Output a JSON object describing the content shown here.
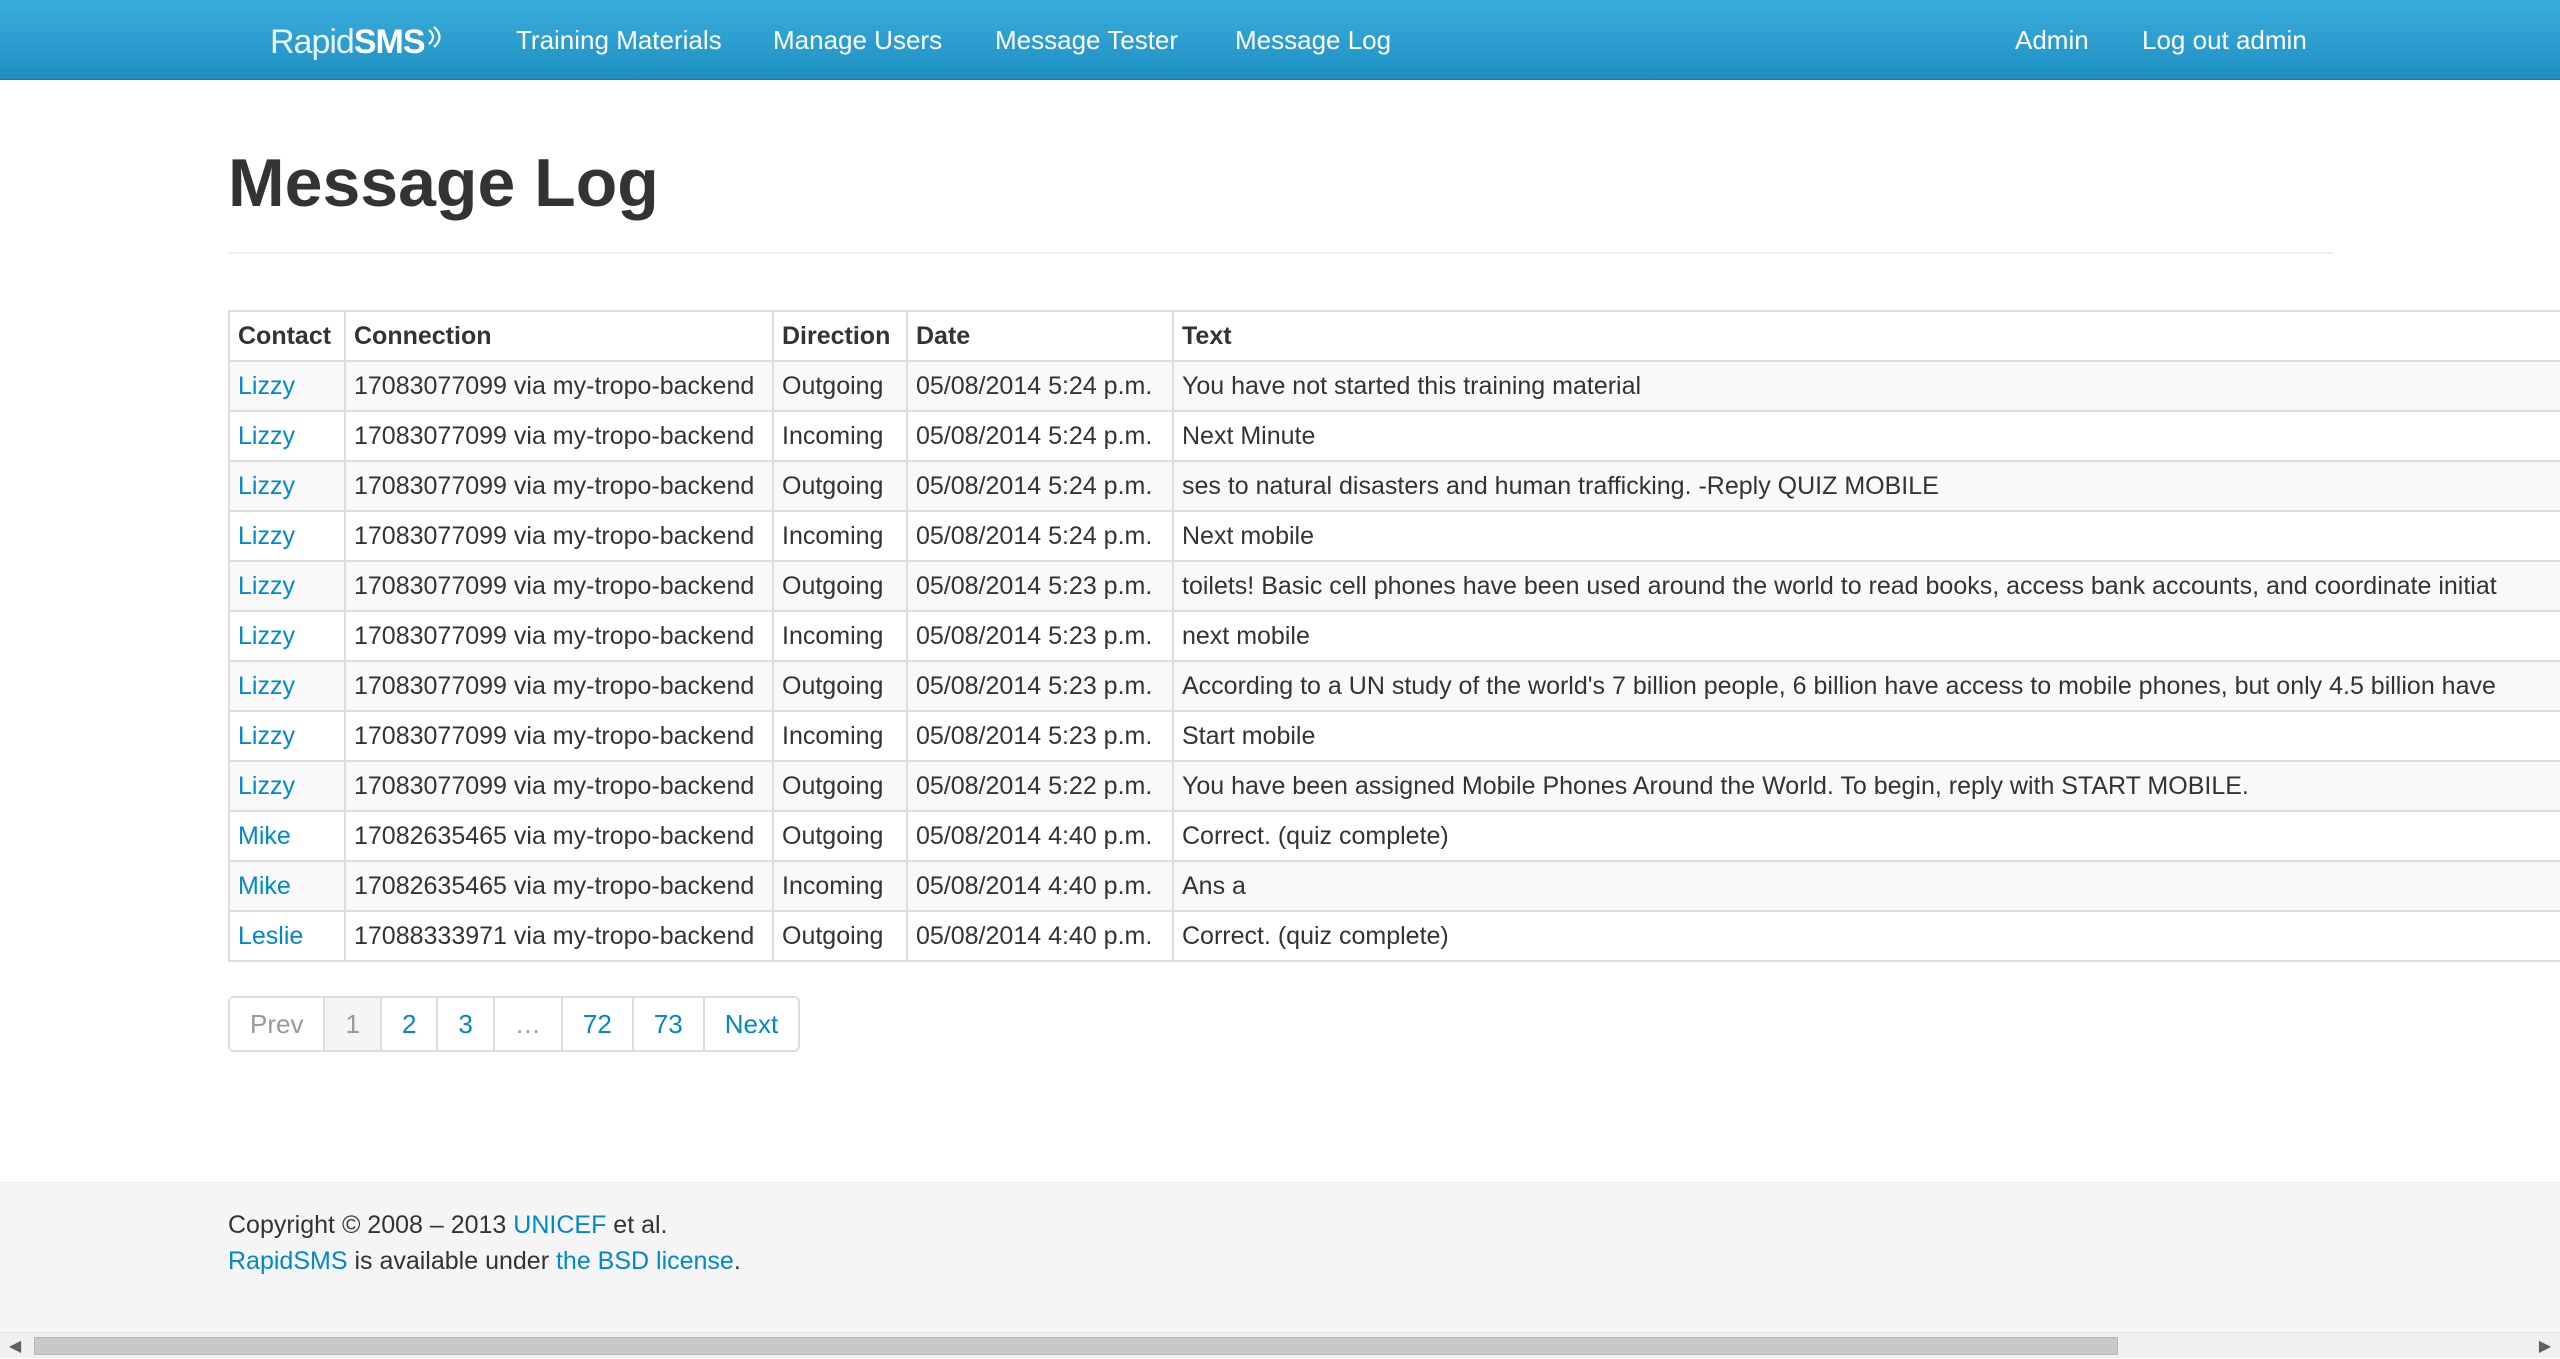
{
  "navbar": {
    "brand_light": "Rapid",
    "brand_bold": "SMS",
    "links": [
      "Training Materials",
      "Manage Users",
      "Message Tester",
      "Message Log"
    ],
    "admin": "Admin",
    "logout": "Log out admin",
    "colors": {
      "bar": "#1f8fc2",
      "text": "#ffffff"
    }
  },
  "page": {
    "title": "Message Log"
  },
  "table": {
    "headers": [
      "Contact",
      "Connection",
      "Direction",
      "Date",
      "Text"
    ],
    "rows": [
      [
        "Lizzy",
        "17083077099 via my-tropo-backend",
        "Outgoing",
        "05/08/2014 5:24 p.m.",
        "You have not started this training material"
      ],
      [
        "Lizzy",
        "17083077099 via my-tropo-backend",
        "Incoming",
        "05/08/2014 5:24 p.m.",
        "Next Minute"
      ],
      [
        "Lizzy",
        "17083077099 via my-tropo-backend",
        "Outgoing",
        "05/08/2014 5:24 p.m.",
        "ses to natural disasters and human trafficking. -Reply QUIZ MOBILE"
      ],
      [
        "Lizzy",
        "17083077099 via my-tropo-backend",
        "Incoming",
        "05/08/2014 5:24 p.m.",
        "Next mobile"
      ],
      [
        "Lizzy",
        "17083077099 via my-tropo-backend",
        "Outgoing",
        "05/08/2014 5:23 p.m.",
        "toilets! Basic cell phones have been used around the world to read books, access bank accounts, and coordinate initiat"
      ],
      [
        "Lizzy",
        "17083077099 via my-tropo-backend",
        "Incoming",
        "05/08/2014 5:23 p.m.",
        "next mobile"
      ],
      [
        "Lizzy",
        "17083077099 via my-tropo-backend",
        "Outgoing",
        "05/08/2014 5:23 p.m.",
        "According to a UN study of the world's 7 billion people, 6 billion have access to mobile phones, but only 4.5 billion have"
      ],
      [
        "Lizzy",
        "17083077099 via my-tropo-backend",
        "Incoming",
        "05/08/2014 5:23 p.m.",
        "Start mobile"
      ],
      [
        "Lizzy",
        "17083077099 via my-tropo-backend",
        "Outgoing",
        "05/08/2014 5:22 p.m.",
        "You have been assigned Mobile Phones Around the World. To begin, reply with START MOBILE."
      ],
      [
        "Mike",
        "17082635465 via my-tropo-backend",
        "Outgoing",
        "05/08/2014 4:40 p.m.",
        "Correct. (quiz complete)"
      ],
      [
        "Mike",
        "17082635465 via my-tropo-backend",
        "Incoming",
        "05/08/2014 4:40 p.m.",
        "Ans a"
      ],
      [
        "Leslie",
        "17088333971 via my-tropo-backend",
        "Outgoing",
        "05/08/2014 4:40 p.m.",
        "Correct. (quiz complete)"
      ]
    ]
  },
  "pagination": {
    "prev": "Prev",
    "pages": [
      "1",
      "2",
      "3",
      "…",
      "72",
      "73"
    ],
    "current": "1",
    "next": "Next"
  },
  "footer": {
    "line1_prefix": "Copyright © 2008 – 2013 ",
    "line1_link": "UNICEF",
    "line1_suffix": " et al.",
    "line2_link1": "RapidSMS",
    "line2_middle": " is available under ",
    "line2_link2": "the BSD license",
    "line2_suffix": "."
  },
  "icons": {
    "brand_signal": "wifi-signal-icon",
    "scroll_left": "scroll-left-arrow-icon",
    "scroll_right": "scroll-right-arrow-icon"
  },
  "colors": {
    "link": "#0088cc",
    "text": "#333333",
    "footer_bg": "#f5f5f5"
  }
}
